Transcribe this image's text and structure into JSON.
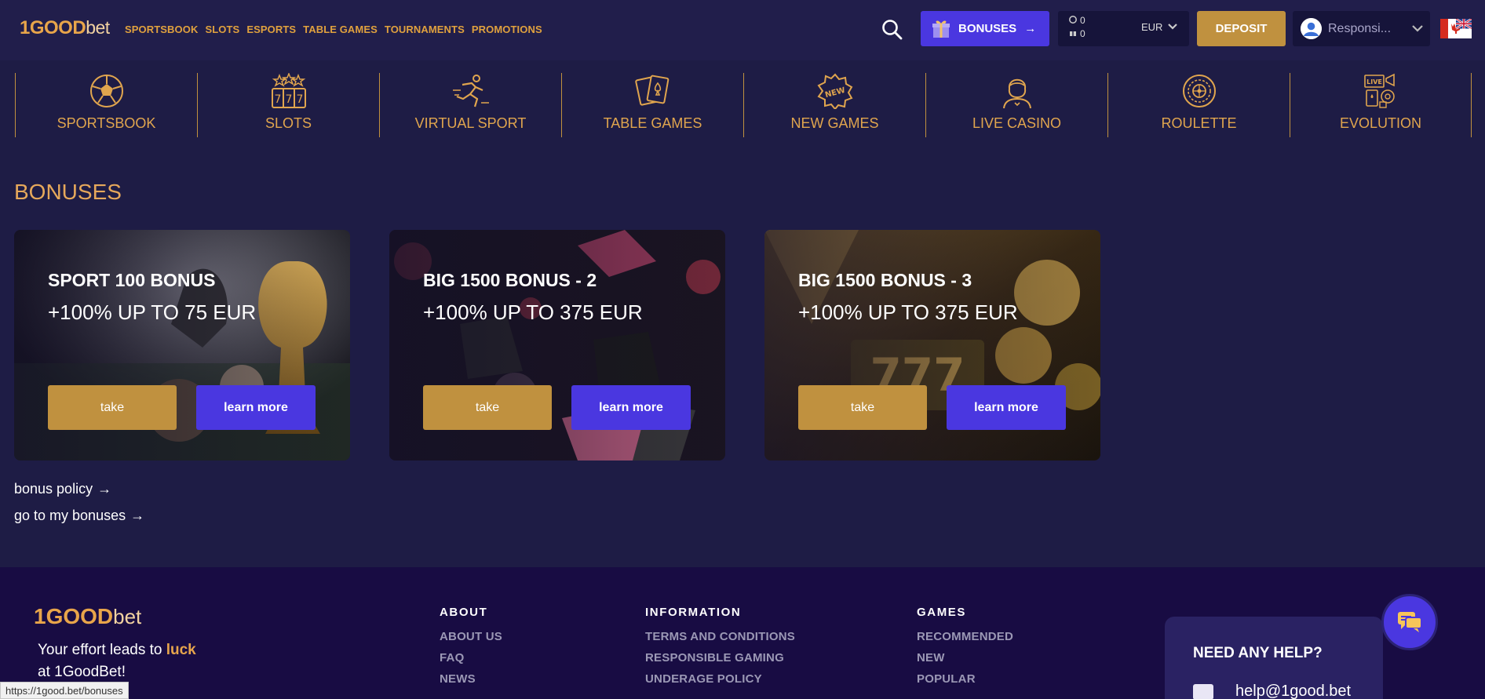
{
  "header": {
    "logo_main": "1GOOD",
    "logo_suffix": "bet",
    "nav": [
      "SPORTSBOOK",
      "SLOTS",
      "ESPORTS",
      "TABLE GAMES",
      "TOURNAMENTS",
      "PROMOTIONS"
    ],
    "bonuses_label": "BONUSES",
    "bonuses_arrow": "→",
    "balance_money": "0",
    "balance_bonus": "0",
    "currency": "EUR",
    "deposit_label": "DEPOSIT",
    "account_label": "Responsi...",
    "language_flag": "flag-canada-uk-icon"
  },
  "categories": [
    {
      "label": "SPORTSBOOK",
      "icon": "soccer-ball-icon"
    },
    {
      "label": "SLOTS",
      "icon": "slot-777-icon"
    },
    {
      "label": "VIRTUAL SPORT",
      "icon": "running-athlete-icon"
    },
    {
      "label": "TABLE GAMES",
      "icon": "playing-cards-icon"
    },
    {
      "label": "NEW GAMES",
      "icon": "new-badge-icon"
    },
    {
      "label": "LIVE CASINO",
      "icon": "dealer-icon"
    },
    {
      "label": "ROULETTE",
      "icon": "roulette-wheel-icon"
    },
    {
      "label": "EVOLUTION",
      "icon": "live-games-icon"
    }
  ],
  "bonuses": {
    "title": "BONUSES",
    "cards": [
      {
        "title": "SPORT 100 BONUS",
        "subtitle": "+100% UP TO 75 EUR",
        "take": "take",
        "learn": "learn more"
      },
      {
        "title": "BIG 1500 BONUS - 2",
        "subtitle": "+100% UP TO 375 EUR",
        "take": "take",
        "learn": "learn more"
      },
      {
        "title": "BIG 1500 BONUS - 3",
        "subtitle": "+100% UP TO 375 EUR",
        "take": "take",
        "learn": "learn more"
      }
    ],
    "bonus_policy": "bonus policy",
    "my_bonuses": "go to my bonuses",
    "arrow": "→"
  },
  "footer": {
    "logo_main": "1GOOD",
    "logo_suffix": "bet",
    "slogan_prefix": "Your effort leads to ",
    "slogan_highlight": "luck",
    "slogan_line2": "at 1GoodBet!",
    "about": {
      "heading": "ABOUT",
      "items": [
        "ABOUT US",
        "FAQ",
        "NEWS"
      ]
    },
    "information": {
      "heading": "INFORMATION",
      "items": [
        "TERMS AND CONDITIONS",
        "RESPONSIBLE GAMING",
        "UNDERAGE POLICY"
      ]
    },
    "games": {
      "heading": "GAMES",
      "items": [
        "RECOMMENDED",
        "NEW",
        "POPULAR"
      ]
    },
    "help_title": "NEED ANY HELP?",
    "help_email": "help@1good.bet"
  },
  "status_bar_url": "https://1good.bet/bonuses",
  "colors": {
    "background": "#1e1c45",
    "gold": "#c0913f",
    "accent_purple": "#4a37e0",
    "footer_bg": "#180c43"
  }
}
